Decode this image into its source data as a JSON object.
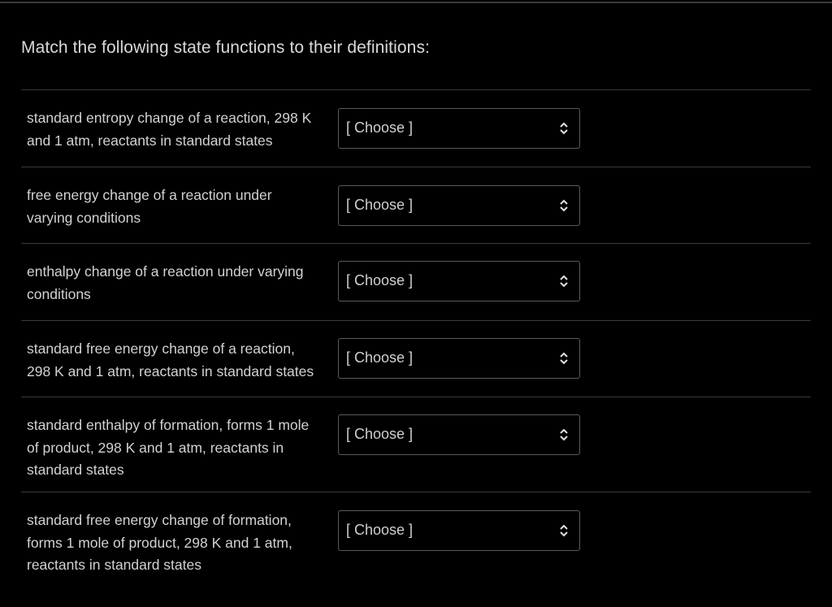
{
  "question": {
    "prompt": "Match the following state functions to their definitions:"
  },
  "matches": [
    {
      "definition_lines": [
        "standard entropy change of a reaction, 298 K",
        "and 1 atm, reactants in standard states"
      ],
      "selected": "[ Choose ]"
    },
    {
      "definition_lines": [
        "free energy change of a reaction under",
        "varying conditions"
      ],
      "selected": "[ Choose ]"
    },
    {
      "definition_lines": [
        "enthalpy change of a reaction under varying",
        "conditions"
      ],
      "selected": "[ Choose ]"
    },
    {
      "definition_lines": [
        "standard free energy change of a reaction,",
        "298 K and 1 atm, reactants in standard states"
      ],
      "selected": "[ Choose ]"
    },
    {
      "definition_lines": [
        "standard enthalpy of formation, forms 1 mole",
        "of product, 298 K and 1 atm, reactants in",
        "standard states"
      ],
      "selected": "[ Choose ]"
    },
    {
      "definition_lines": [
        "standard free energy change of formation,",
        "forms 1 mole of product, 298 K and 1 atm,",
        "reactants in standard states"
      ],
      "selected": "[ Choose ]"
    }
  ],
  "icons": {
    "dropdown": "up-down-chevron-icon"
  }
}
